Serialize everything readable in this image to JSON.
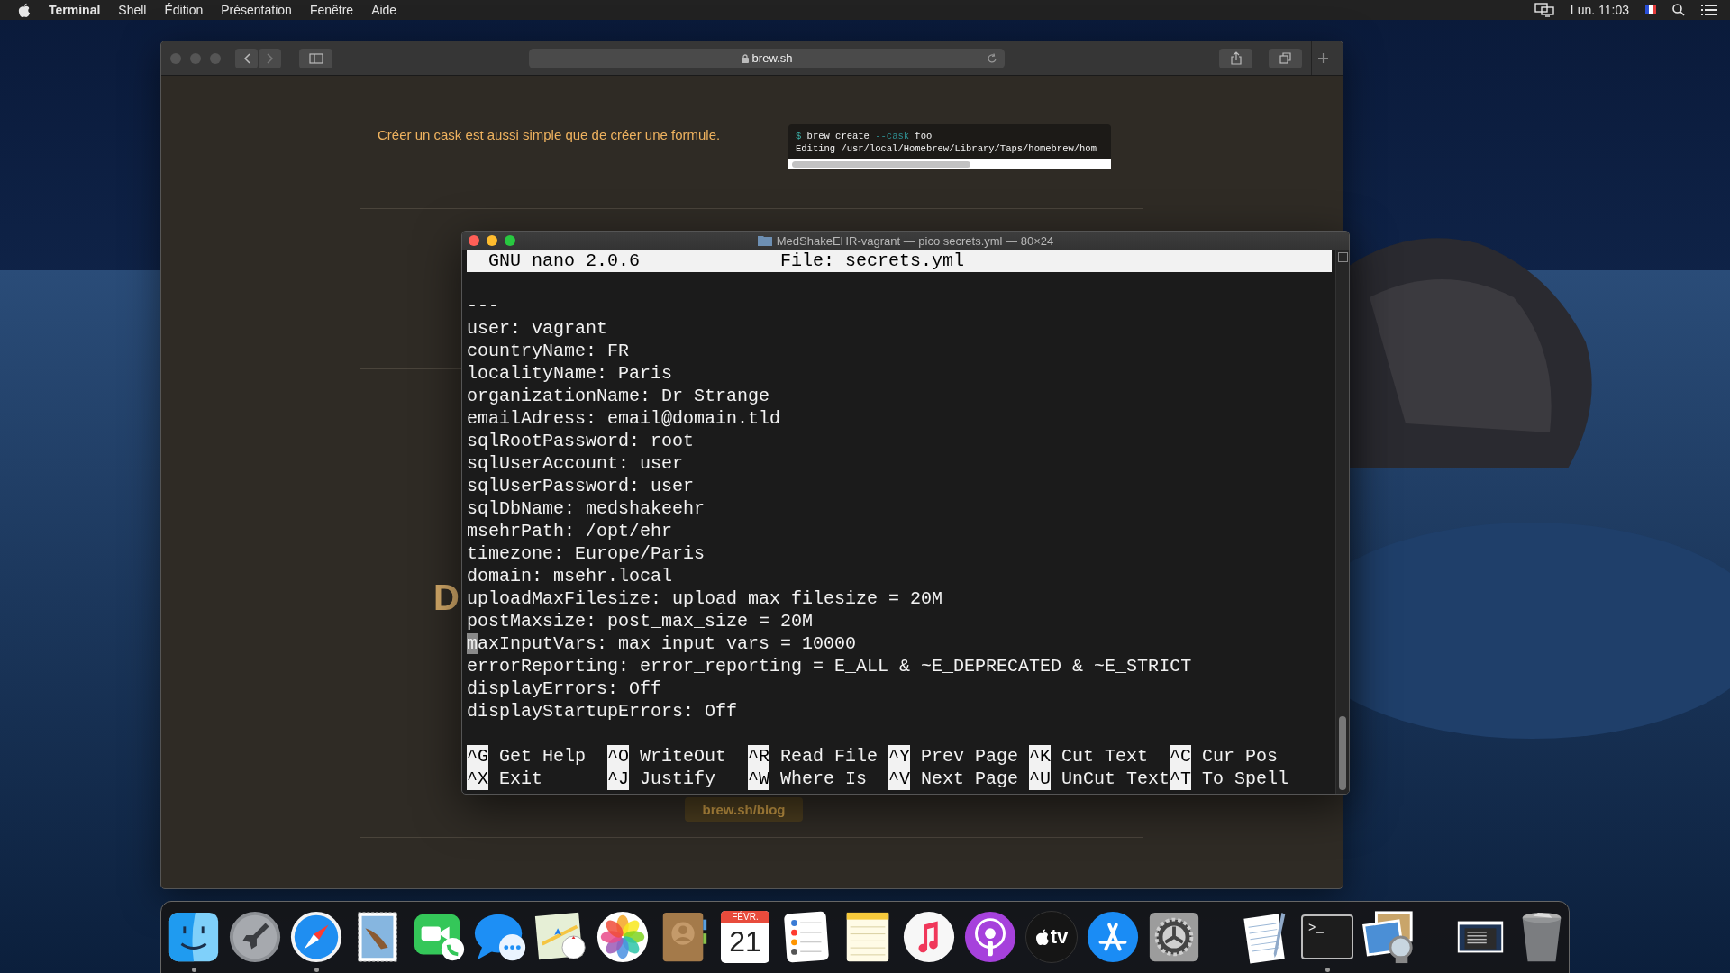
{
  "menu_bar": {
    "app_name": "Terminal",
    "menus": [
      "Shell",
      "Édition",
      "Présentation",
      "Fenêtre",
      "Aide"
    ],
    "clock": "Lun. 11:03"
  },
  "browser": {
    "url": "brew.sh",
    "intro": "Créer un cask est aussi simple que de créer une formule.",
    "code_lines": [
      {
        "segments": [
          {
            "kind": "prompt",
            "text": "$ "
          },
          {
            "kind": "plain",
            "text": "brew create "
          },
          {
            "kind": "flag",
            "text": "--cask"
          },
          {
            "kind": "plain",
            "text": " foo"
          }
        ]
      },
      {
        "segments": [
          {
            "kind": "plain",
            "text": "Editing /usr/local/Homebrew/Library/Taps/homebrew/hom"
          }
        ]
      }
    ],
    "heading_fragment": "D",
    "link_button": "brew.sh/blog"
  },
  "terminal": {
    "title": "MedShakeEHR-vagrant — pico secrets.yml — 80×24",
    "header": {
      "version": "GNU nano 2.0.6",
      "file": "File: secrets.yml"
    },
    "lines": [
      {
        "text": "---",
        "cursor": false
      },
      {
        "text": "user: vagrant",
        "cursor": false
      },
      {
        "text": "countryName: FR",
        "cursor": false
      },
      {
        "text": "localityName: Paris",
        "cursor": false
      },
      {
        "text": "organizationName: Dr Strange",
        "cursor": false
      },
      {
        "text": "emailAdress: email@domain.tld",
        "cursor": false
      },
      {
        "text": "sqlRootPassword: root",
        "cursor": false
      },
      {
        "text": "sqlUserAccount: user",
        "cursor": false
      },
      {
        "text": "sqlUserPassword: user",
        "cursor": false
      },
      {
        "text": "sqlDbName: medshakeehr",
        "cursor": false
      },
      {
        "text": "msehrPath: /opt/ehr",
        "cursor": false
      },
      {
        "text": "timezone: Europe/Paris",
        "cursor": false
      },
      {
        "text": "domain: msehr.local",
        "cursor": false
      },
      {
        "text": "uploadMaxFilesize: upload_max_filesize = 20M",
        "cursor": false
      },
      {
        "text": "postMaxsize: post_max_size = 20M",
        "cursor": false
      },
      {
        "text": "maxInputVars: max_input_vars = 10000",
        "cursor": true
      },
      {
        "text": "errorReporting: error_reporting = E_ALL & ~E_DEPRECATED & ~E_STRICT",
        "cursor": false
      },
      {
        "text": "displayErrors: Off",
        "cursor": false
      },
      {
        "text": "displayStartupErrors: Off",
        "cursor": false
      }
    ],
    "shortcut_rows": [
      {
        "items": [
          {
            "key": "^G",
            "label": "Get Help"
          },
          {
            "key": "^O",
            "label": "WriteOut"
          },
          {
            "key": "^R",
            "label": "Read File"
          },
          {
            "key": "^Y",
            "label": "Prev Page"
          },
          {
            "key": "^K",
            "label": "Cut Text"
          },
          {
            "key": "^C",
            "label": "Cur Pos"
          }
        ]
      },
      {
        "items": [
          {
            "key": "^X",
            "label": "Exit"
          },
          {
            "key": "^J",
            "label": "Justify"
          },
          {
            "key": "^W",
            "label": "Where Is"
          },
          {
            "key": "^V",
            "label": "Next Page"
          },
          {
            "key": "^U",
            "label": "UnCut Text"
          },
          {
            "key": "^T",
            "label": "To Spell"
          }
        ]
      }
    ]
  },
  "dock": {
    "items": [
      {
        "kind": "finder",
        "running": true
      },
      {
        "kind": "launchpad",
        "running": false
      },
      {
        "kind": "safari",
        "running": true
      },
      {
        "kind": "mail",
        "running": false
      },
      {
        "kind": "facetime",
        "running": false
      },
      {
        "kind": "messages",
        "running": false
      },
      {
        "kind": "maps",
        "running": false
      },
      {
        "kind": "photos",
        "running": false
      },
      {
        "kind": "contacts",
        "running": false
      },
      {
        "kind": "calendar",
        "month": "FÉVR.",
        "day": "21",
        "running": false
      },
      {
        "kind": "reminders",
        "running": false
      },
      {
        "kind": "notes",
        "running": false
      },
      {
        "kind": "music",
        "running": false
      },
      {
        "kind": "podcasts",
        "running": false
      },
      {
        "kind": "tv",
        "label": "tv",
        "running": false
      },
      {
        "kind": "appstore",
        "running": false
      },
      {
        "kind": "settings",
        "running": false
      },
      {
        "kind": "separator"
      },
      {
        "kind": "textedit",
        "running": false
      },
      {
        "kind": "terminal",
        "label": ">_",
        "running": true
      },
      {
        "kind": "preview",
        "running": false
      },
      {
        "kind": "separator"
      },
      {
        "kind": "window",
        "running": false
      },
      {
        "kind": "trash",
        "running": false
      }
    ]
  }
}
